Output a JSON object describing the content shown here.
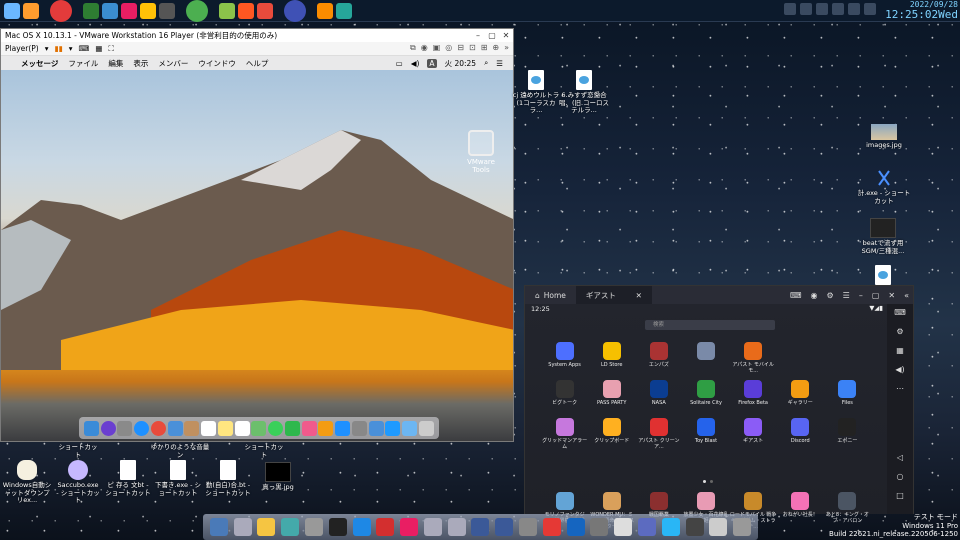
{
  "clock": {
    "date": "2022/09/28",
    "time": "12:25:02Wed"
  },
  "topbar": {
    "icons": [
      "#6bb7ff",
      "#ff9c2e",
      "#e33b3b",
      "#2e7d32",
      "#3b8ed0",
      "#e91e63",
      "#ffc107",
      "#555",
      "#4caf50",
      "#8bc34a",
      "#ff5722",
      "#e84b3c",
      "#3f51b5",
      "#fb8c00",
      "#26a69a"
    ]
  },
  "vmware": {
    "title": "Mac OS X 10.13.1 - VMware Workstation 16 Player (非営利目的の使用のみ)",
    "player_menu": "Player(P)",
    "mac_menu": [
      "メッセージ",
      "ファイル",
      "編集",
      "表示",
      "メンバー",
      "ウインドウ",
      "ヘルプ"
    ],
    "mac_clock": "火 20:25",
    "input_source": "A",
    "vmtools_label": "VMware Tools"
  },
  "desktop": {
    "wav_label": "cj 遠めウルトラ(1コーラスカラ...",
    "mp3_label": "6.みすず恋愛合唱、(旧.コーロステルラ...",
    "images_label": "images.jpg",
    "lnk_label": "計.exe - ショートカット",
    "beat_label": "beatで流す用SGM/三種混...",
    "shortcut_label": "ショートカット",
    "color_label": "ゆかりのような音量ン",
    "icon1": "Windows自動シャットダウンプリex...",
    "icon2": "Saccubo.exe - ショートカット",
    "icon3": "ピ 存る 文bt - ショートカット",
    "icon4": "下書き.exe - ショートカット",
    "icon5": "勤(自白)合.bt - ショートカット",
    "icon6": "真っ黒.jpg"
  },
  "ld": {
    "tab_home": "Home",
    "tab_active": "ギアスト",
    "status_time": "12:25",
    "search_placeholder": "検索",
    "apps_row1": [
      {
        "label": "System Apps",
        "color": "#4d6fff"
      },
      {
        "label": "LD Store",
        "color": "#f6c000"
      },
      {
        "label": "エンパズ",
        "color": "#a33"
      },
      {
        "label": "",
        "color": "#7a8aa8"
      },
      {
        "label": "アパスト モバイル モ...",
        "color": "#e96b1a"
      },
      {
        "label": "",
        "color": "transparent"
      },
      {
        "label": "",
        "color": "transparent"
      }
    ],
    "apps_row2": [
      {
        "label": "ビグトーク",
        "color": "#333"
      },
      {
        "label": "PASS PARTY",
        "color": "#e8a0b0"
      },
      {
        "label": "NASA",
        "color": "#0b3d91"
      },
      {
        "label": "Solitaire City",
        "color": "#2f9e44"
      },
      {
        "label": "Firefox Beta",
        "color": "#5a3dd8"
      },
      {
        "label": "ギャラリー",
        "color": "#f39c12"
      },
      {
        "label": "Files",
        "color": "#3b82f6"
      }
    ],
    "apps_row3": [
      {
        "label": "グリッドマンアラーム",
        "color": "#c678dd"
      },
      {
        "label": "クリップボード",
        "color": "#ffb020"
      },
      {
        "label": "アパスト クリーンア...",
        "color": "#e03131"
      },
      {
        "label": "Toy Blast",
        "color": "#2563eb"
      },
      {
        "label": "ギアスト",
        "color": "#8b5cf6"
      },
      {
        "label": "Discord",
        "color": "#5865f2"
      },
      {
        "label": "エポニー",
        "color": "#222"
      }
    ],
    "apps_row4": [
      {
        "label": "モリノファンタジー：世界樹の伝説",
        "color": "#63a4d6"
      },
      {
        "label": "WONDER MU：ミューと運命のモンスター",
        "color": "#d9a05b"
      },
      {
        "label": "戦国覇業",
        "color": "#8b2f2f"
      },
      {
        "label": "放置少女・百花繚乱の萌姫たち",
        "color": "#e89bb4"
      },
      {
        "label": "ロードモバイル 戦争キングダム・ストラテ...",
        "color": "#c88a2a"
      },
      {
        "label": "おねがい社長！",
        "color": "#f472b6"
      },
      {
        "label": "あと8：キング・オブ・アバロン",
        "color": "#4b5563"
      }
    ]
  },
  "watermark": {
    "line1": "テスト モード",
    "line2": "Windows 11 Pro",
    "line3": "Build 22621.ni_release.220506-1250"
  }
}
